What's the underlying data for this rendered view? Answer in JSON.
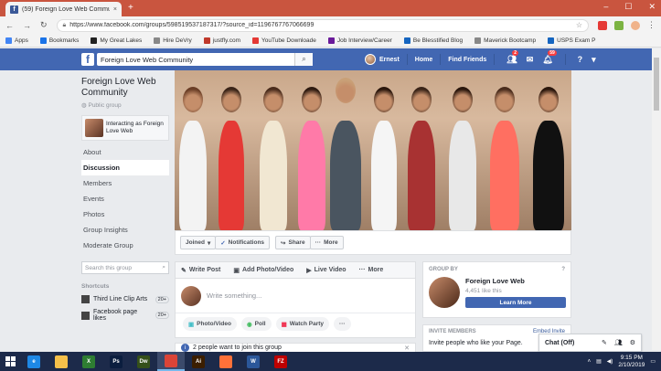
{
  "browser": {
    "tab_title": "(59) Foreign Love Web Commu",
    "tab_close": "×",
    "new_tab": "+",
    "url": "https://www.facebook.com/groups/598519537187317/?source_id=1196767767066699",
    "bookmarks": [
      {
        "label": "Apps",
        "color": "#4285f4"
      },
      {
        "label": "Bookmarks",
        "color": "#1a73e8"
      },
      {
        "label": "My Great Lakes",
        "color": "#222222"
      },
      {
        "label": "Hire DeVry",
        "color": "#888888"
      },
      {
        "label": "justfly.com",
        "color": "#c0392b"
      },
      {
        "label": "YouTube Downloade",
        "color": "#e53935"
      },
      {
        "label": "Job Interview/Career",
        "color": "#6a1b9a"
      },
      {
        "label": "Be Blesstified Blog",
        "color": "#1565c0"
      },
      {
        "label": "Maverick Bootcamp",
        "color": "#888888"
      },
      {
        "label": "USPS Exam P",
        "color": "#1565c0"
      }
    ]
  },
  "fb": {
    "logo": "f",
    "search_value": "Foreign Love Web Community",
    "user_name": "Ernest",
    "nav_home": "Home",
    "nav_find_friends": "Find Friends",
    "badge_friends": "2",
    "badge_notifications": "59"
  },
  "group": {
    "title": "Foreign Love Web Community",
    "type": "Public group",
    "interacting_as": "Interacting as Foreign Love Web",
    "nav": [
      "About",
      "Discussion",
      "Members",
      "Events",
      "Photos",
      "Group Insights",
      "Moderate Group"
    ],
    "active_nav": "Discussion",
    "search_placeholder": "Search this group",
    "shortcuts_heading": "Shortcuts",
    "shortcuts": [
      {
        "label": "Third Line Clip Arts",
        "count": "20+"
      },
      {
        "label": "Facebook page likes",
        "count": "20+"
      }
    ]
  },
  "actions": {
    "joined": "Joined",
    "notifications": "Notifications",
    "share": "Share",
    "more": "More"
  },
  "composer": {
    "tabs": [
      "Write Post",
      "Add Photo/Video",
      "Live Video",
      "More"
    ],
    "placeholder": "Write something...",
    "pills": [
      "Photo/Video",
      "Poll",
      "Watch Party"
    ],
    "more_dots": "···",
    "join_text": "2 people want to join this group"
  },
  "group_card": {
    "heading": "GROUP BY",
    "name": "Foreign Love Web",
    "likes": "4,451 like this",
    "button": "Learn More"
  },
  "invite_card": {
    "heading": "INVITE MEMBERS",
    "link": "Embed Invite",
    "text": "Invite people who like your Page."
  },
  "chat": {
    "label": "Chat (Off)"
  },
  "taskbar": {
    "apps": [
      {
        "label": "e",
        "color": "#1e88e5"
      },
      {
        "label": "",
        "color": "#f5c04a"
      },
      {
        "label": "X",
        "color": "#2e7d32"
      },
      {
        "label": "Ps",
        "color": "#0b1e3f"
      },
      {
        "label": "Dw",
        "color": "#35501a"
      },
      {
        "label": "",
        "color": "#db4437"
      },
      {
        "label": "Ai",
        "color": "#3b1e00"
      },
      {
        "label": "",
        "color": "#ff7139"
      },
      {
        "label": "W",
        "color": "#2b579a"
      },
      {
        "label": "FZ",
        "color": "#bf0000"
      }
    ],
    "active_index": 5,
    "time": "9:15 PM",
    "date": "2/10/2019"
  }
}
